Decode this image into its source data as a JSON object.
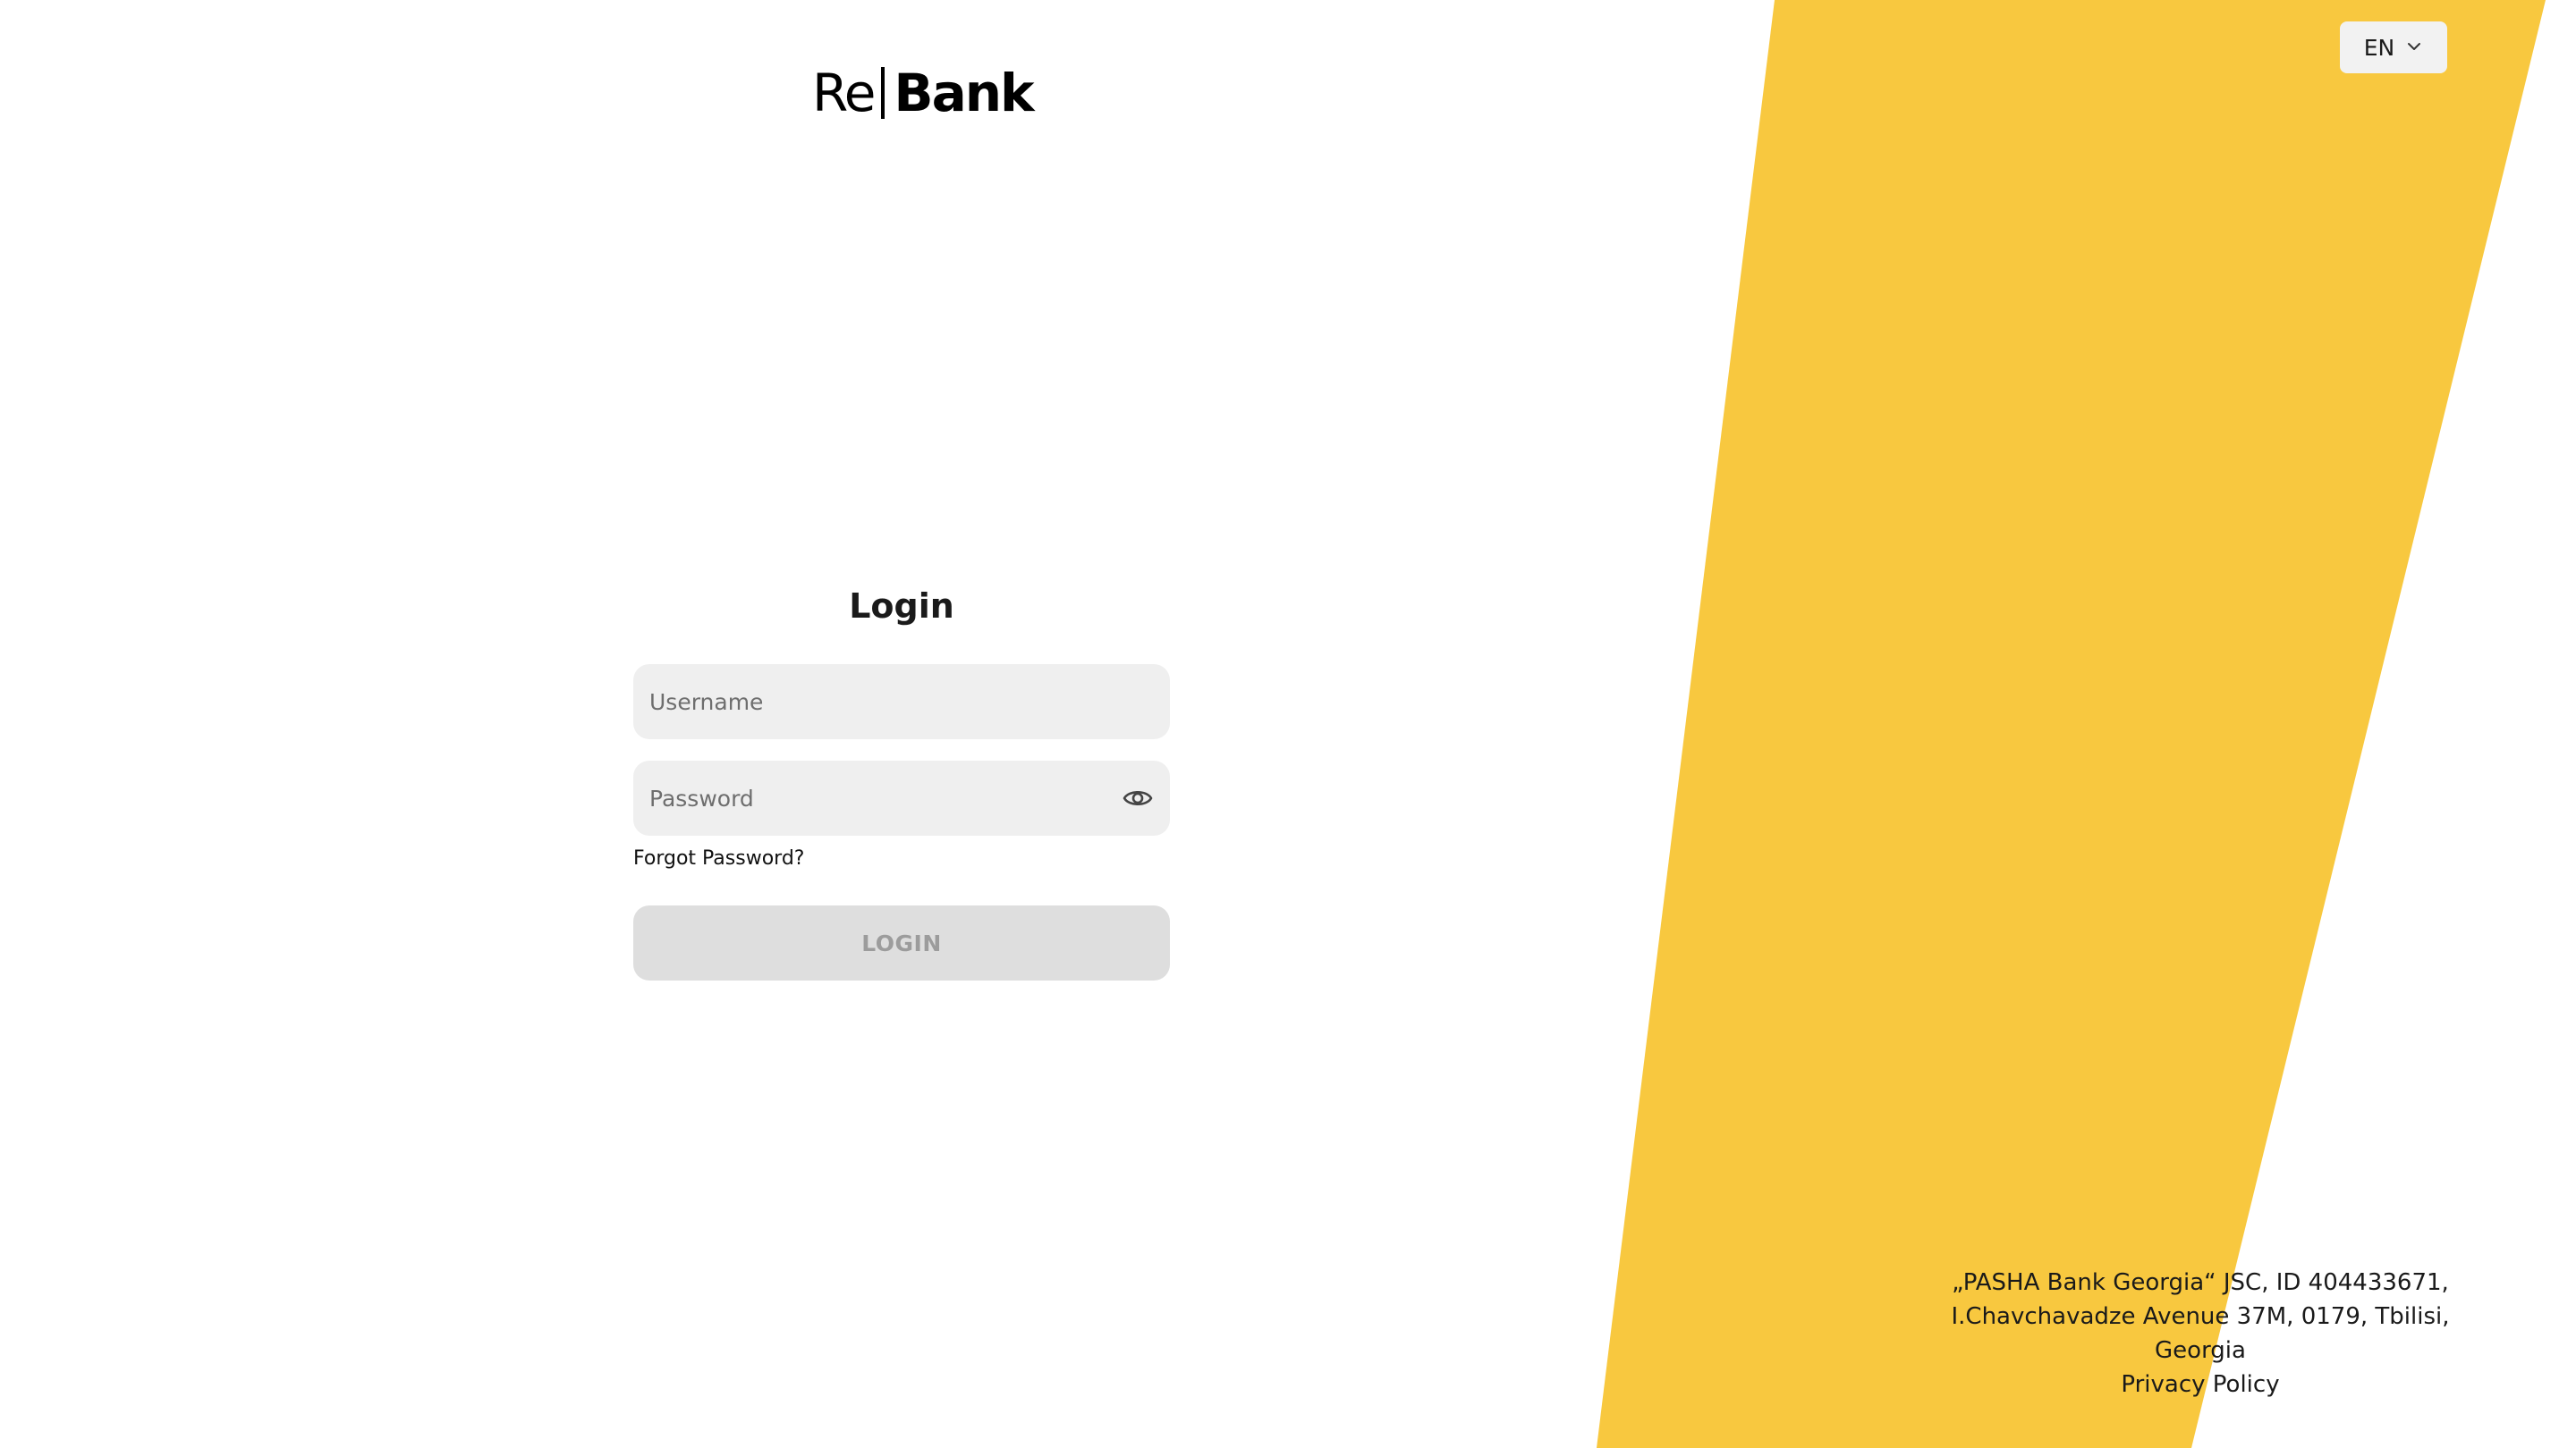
{
  "brand": {
    "logo_part1": "Re",
    "logo_part2": "Bank",
    "accent_color": "#f8c83f"
  },
  "language": {
    "selected": "EN"
  },
  "login": {
    "title": "Login",
    "username_placeholder": "Username",
    "username_value": "",
    "password_placeholder": "Password",
    "password_value": "",
    "forgot_label": "Forgot Password?",
    "submit_label": "LOGIN"
  },
  "icons": {
    "language_dropdown": "chevron-down-icon",
    "password_toggle": "eye-icon"
  },
  "footer": {
    "address_line1": "„PASHA Bank Georgia“ JSC, ID 404433671,",
    "address_line2": "I.Chavchavadze Avenue 37M, 0179, Tbilisi,",
    "address_line3": "Georgia",
    "privacy_label": "Privacy Policy"
  }
}
